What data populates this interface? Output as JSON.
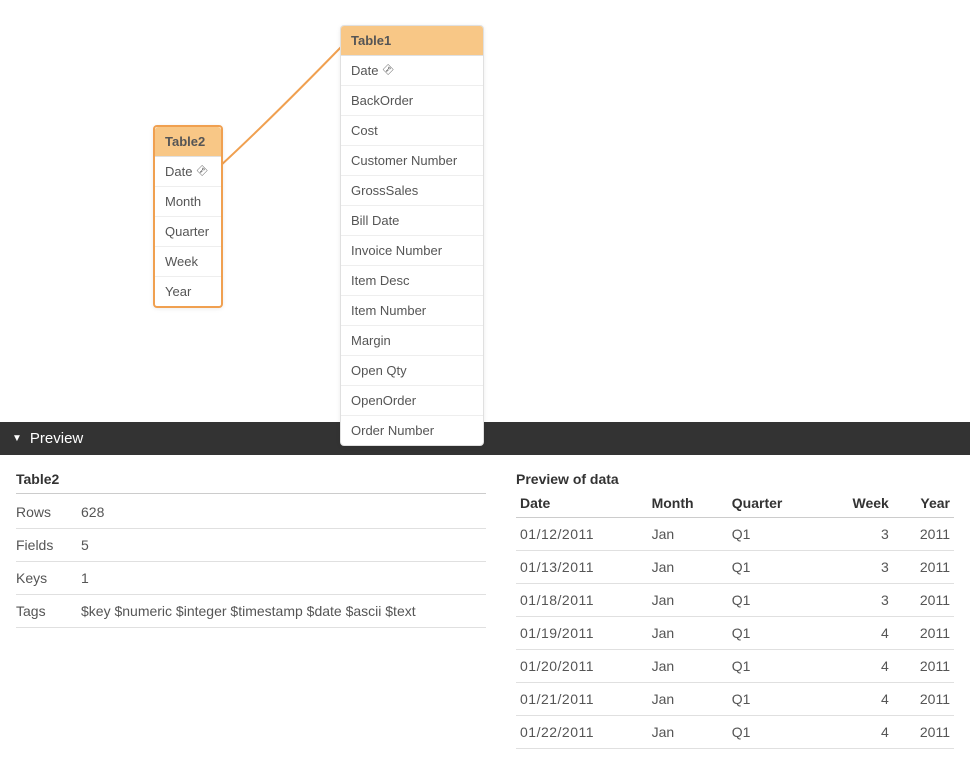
{
  "tables": {
    "table2": {
      "name": "Table2",
      "fields": [
        {
          "name": "Date",
          "key": true
        },
        {
          "name": "Month",
          "key": false
        },
        {
          "name": "Quarter",
          "key": false
        },
        {
          "name": "Week",
          "key": false
        },
        {
          "name": "Year",
          "key": false
        }
      ]
    },
    "table1": {
      "name": "Table1",
      "fields": [
        {
          "name": "Date",
          "key": true
        },
        {
          "name": "BackOrder",
          "key": false
        },
        {
          "name": "Cost",
          "key": false
        },
        {
          "name": "Customer Number",
          "key": false
        },
        {
          "name": "GrossSales",
          "key": false
        },
        {
          "name": "Bill Date",
          "key": false
        },
        {
          "name": "Invoice Number",
          "key": false
        },
        {
          "name": "Item Desc",
          "key": false
        },
        {
          "name": "Item Number",
          "key": false
        },
        {
          "name": "Margin",
          "key": false
        },
        {
          "name": "Open Qty",
          "key": false
        },
        {
          "name": "OpenOrder",
          "key": false
        },
        {
          "name": "Order Number",
          "key": false
        }
      ]
    }
  },
  "preview": {
    "title": "Preview",
    "stats": {
      "title": "Table2",
      "rows_label": "Rows",
      "rows_value": "628",
      "fields_label": "Fields",
      "fields_value": "5",
      "keys_label": "Keys",
      "keys_value": "1",
      "tags_label": "Tags",
      "tags_value": "$key $numeric $integer $timestamp $date $ascii $text"
    },
    "data": {
      "title": "Preview of data",
      "columns": [
        "Date",
        "Month",
        "Quarter",
        "Week",
        "Year"
      ],
      "rows": [
        [
          "01/12/2011",
          "Jan",
          "Q1",
          "3",
          "2011"
        ],
        [
          "01/13/2011",
          "Jan",
          "Q1",
          "3",
          "2011"
        ],
        [
          "01/18/2011",
          "Jan",
          "Q1",
          "3",
          "2011"
        ],
        [
          "01/19/2011",
          "Jan",
          "Q1",
          "4",
          "2011"
        ],
        [
          "01/20/2011",
          "Jan",
          "Q1",
          "4",
          "2011"
        ],
        [
          "01/21/2011",
          "Jan",
          "Q1",
          "4",
          "2011"
        ],
        [
          "01/22/2011",
          "Jan",
          "Q1",
          "4",
          "2011"
        ]
      ]
    }
  }
}
